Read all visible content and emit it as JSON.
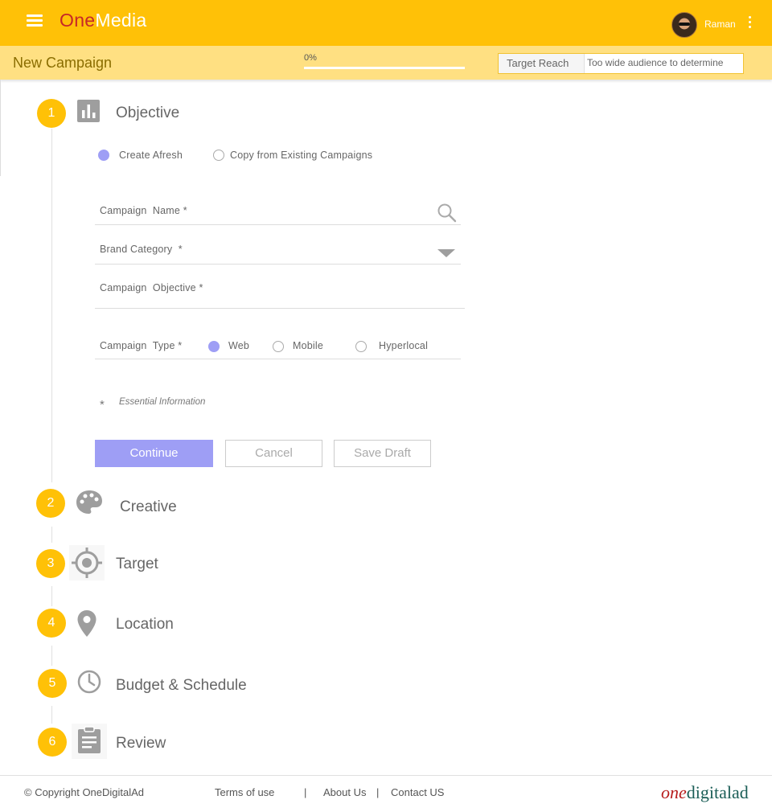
{
  "app": {
    "logo_one": "One",
    "logo_media": "Media",
    "user_name": "Raman"
  },
  "subbar": {
    "title": "New Campaign",
    "progress_text": "0%",
    "progress_value": 0,
    "target_reach_label": "Target Reach",
    "target_reach_value": "Too wide audience to determine"
  },
  "steps": [
    {
      "number": "1",
      "title": "Objective",
      "icon": "bar-chart-icon"
    },
    {
      "number": "2",
      "title": "Creative",
      "icon": "palette-icon"
    },
    {
      "number": "3",
      "title": "Target",
      "icon": "crosshair-icon"
    },
    {
      "number": "4",
      "title": "Location",
      "icon": "map-pin-icon"
    },
    {
      "number": "5",
      "title": "Budget & Schedule",
      "icon": "clock-icon"
    },
    {
      "number": "6",
      "title": "Review",
      "icon": "clipboard-icon"
    }
  ],
  "objective": {
    "source_options": [
      {
        "label": "Create Afresh",
        "selected": true
      },
      {
        "label": "Copy from Existing Campaigns",
        "selected": false
      }
    ],
    "campaign_name_label": "Campaign  Name *",
    "brand_category_label": "Brand Category  *",
    "campaign_objective_label": "Campaign  Objective *",
    "campaign_type_label": "Campaign  Type *",
    "type_options": [
      {
        "label": "Web",
        "selected": true
      },
      {
        "label": "Mobile",
        "selected": false
      },
      {
        "label": "Hyperlocal",
        "selected": false
      }
    ],
    "essential_star": "*",
    "essential_text": "Essential Information",
    "buttons": {
      "continue": "Continue",
      "cancel": "Cancel",
      "save_draft": "Save Draft"
    }
  },
  "footer": {
    "copyright": "© Copyright OneDigitalAd",
    "terms": "Terms of use",
    "sep": "|",
    "about": "About Us",
    "contact": "Contact US",
    "brand_one": "one",
    "brand_rest": "digitalad"
  },
  "colors": {
    "primary": "#ffc107",
    "subbar": "#ffe082",
    "accent": "#9e9ef5",
    "brand_red": "#c62828"
  }
}
